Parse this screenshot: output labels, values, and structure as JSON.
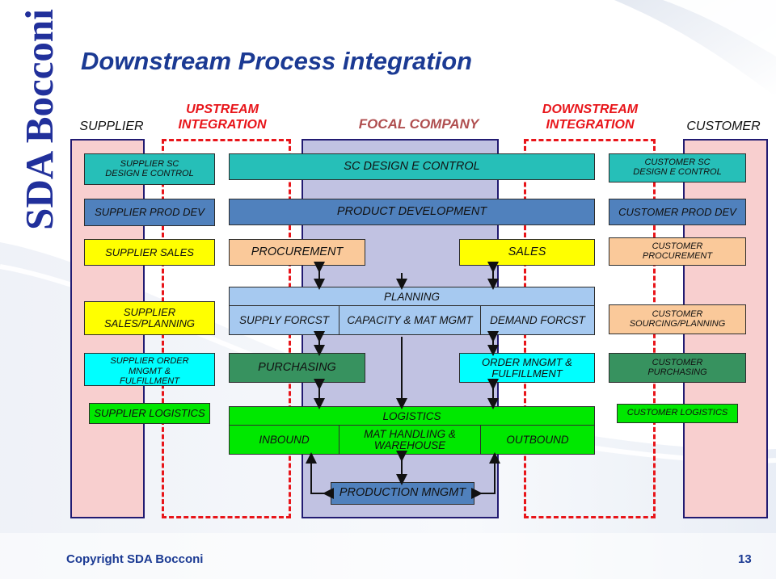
{
  "logo": {
    "text": "SDA Bocconi"
  },
  "title": "Downstream Process integration",
  "headers": {
    "supplier": "SUPPLIER",
    "upstream_line1": "UPSTREAM",
    "upstream_line2": "INTEGRATION",
    "focal": "FOCAL COMPANY",
    "downstream_line1": "DOWNSTREAM",
    "downstream_line2": "INTEGRATION",
    "customer": "CUSTOMER"
  },
  "supplier_boxes": [
    {
      "label": "SUPPLIER SC\nDESIGN E CONTROL",
      "color": "#26BFB8"
    },
    {
      "label": "SUPPLIER PROD DEV",
      "color": "#5081BD"
    },
    {
      "label": "SUPPLIER SALES",
      "color": "#FFFF00"
    },
    {
      "label": "SUPPLIER\nSALES/PLANNING",
      "color": "#FFFF00"
    },
    {
      "label": "SUPPLIER ORDER\nMNGMT &\nFULFILLMENT",
      "color": "#00FFFF"
    },
    {
      "label": "SUPPLIER LOGISTICS",
      "color": "#00E800"
    }
  ],
  "focal_boxes": {
    "sc_design": "SC DESIGN E CONTROL",
    "product_development": "PRODUCT DEVELOPMENT",
    "procurement": "PROCUREMENT",
    "sales": "SALES",
    "planning_title": "PLANNING",
    "supply_forcst": "SUPPLY FORCST",
    "capacity_mat_mgmt": "CAPACITY & MAT MGMT",
    "demand_forcst": "DEMAND FORCST",
    "purchasing": "PURCHASING",
    "order_mngmt": "ORDER MNGMT &\nFULFILLMENT",
    "logistics_title": "LOGISTICS",
    "inbound": "INBOUND",
    "mat_handling": "MAT HANDLING &\nWAREHOUSE",
    "outbound": "OUTBOUND",
    "production_mngmt": "PRODUCTION MNGMT"
  },
  "customer_boxes": [
    {
      "label": "CUSTOMER SC\nDESIGN E CONTROL",
      "color": "#26BFB8"
    },
    {
      "label": "CUSTOMER PROD DEV",
      "color": "#5081BD"
    },
    {
      "label": "CUSTOMER\nPROCUREMENT",
      "color": "#FAC99A"
    },
    {
      "label": "CUSTOMER\nSOURCING/PLANNING",
      "color": "#FAC99A"
    },
    {
      "label": "CUSTOMER\nPURCHASING",
      "color": "#37925F"
    },
    {
      "label": "CUSTOMER LOGISTICS",
      "color": "#00E800"
    }
  ],
  "footer": {
    "copyright": "Copyright SDA Bocconi",
    "page": "13"
  },
  "colors": {
    "teal": "#26BFB8",
    "steel_blue": "#5081BD",
    "yellow": "#FFFF00",
    "peach": "#FAC99A",
    "light_blue": "#A6C9F0",
    "green_dark": "#37925F",
    "cyan": "#00FFFF",
    "green_bright": "#00E800",
    "panel_pink": "#F8CFCF",
    "panel_lavender": "#C1C2E2",
    "border_navy": "#221B72",
    "red_dash": "#E8151A",
    "title_blue": "#1B3A93"
  }
}
